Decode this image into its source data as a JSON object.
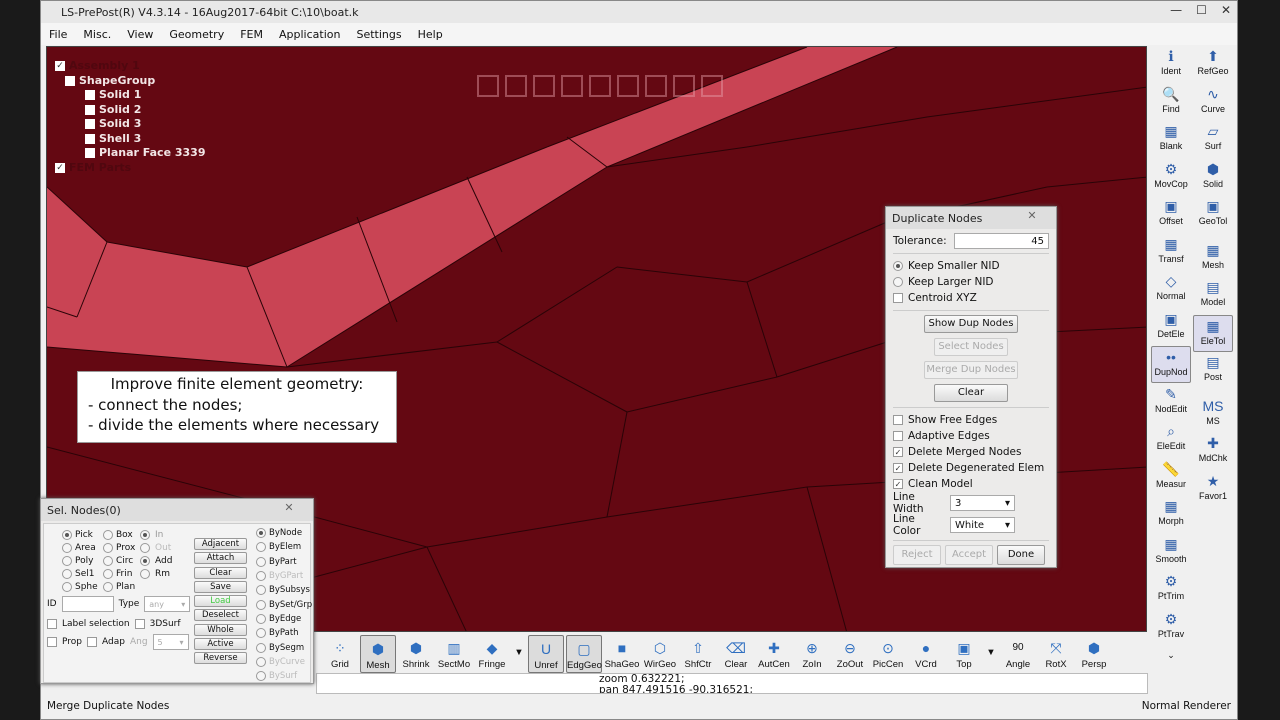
{
  "window": {
    "title": "LS-PrePost(R) V4.3.14 - 16Aug2017-64bit C:\\10\\boat.k",
    "min": "—",
    "max": "☐",
    "close": "✕"
  },
  "menu": [
    "File",
    "Misc.",
    "View",
    "Geometry",
    "FEM",
    "Application",
    "Settings",
    "Help"
  ],
  "tree": {
    "items": [
      {
        "label": "Assembly 1",
        "checked": true,
        "dim": true,
        "indent": 0
      },
      {
        "label": "ShapeGroup",
        "checked": false,
        "indent": 1
      },
      {
        "label": "Solid 1",
        "checked": false,
        "indent": 2
      },
      {
        "label": "Solid 2",
        "checked": false,
        "indent": 2
      },
      {
        "label": "Solid 3",
        "checked": false,
        "indent": 2
      },
      {
        "label": "Shell 3",
        "checked": false,
        "indent": 2
      },
      {
        "label": "Planar Face 3339",
        "checked": false,
        "indent": 2
      },
      {
        "label": "FEM Parts",
        "checked": true,
        "dim": true,
        "indent": 0
      }
    ]
  },
  "note": {
    "line1": "Improve finite element geometry:",
    "line2": "- connect the nodes;",
    "line3": "- divide the elements where necessary"
  },
  "viewport_colors": {
    "background": "#640812",
    "band": "#c94454",
    "lines": "#2a0307"
  },
  "dup": {
    "title": "Duplicate Nodes",
    "close": "✕",
    "tolerance_label": "Tolerance:",
    "tolerance": "45",
    "keep_smaller": "Keep Smaller NID",
    "keep_larger": "Keep Larger NID",
    "centroid": "Centroid XYZ",
    "show": "Show Dup Nodes",
    "select": "Select Nodes",
    "merge": "Merge Dup Nodes",
    "clear": "Clear",
    "free_edges": "Show Free Edges",
    "adaptive": "Adaptive Edges",
    "del_merged": "Delete Merged Nodes",
    "del_degen": "Delete Degenerated Elem",
    "clean": "Clean Model",
    "line_width_label": "Line Width",
    "line_width": "3",
    "line_color_label": "Line Color",
    "line_color": "White",
    "reject": "Reject",
    "accept": "Accept",
    "done": "Done"
  },
  "sel": {
    "title": "Sel. Nodes(0)",
    "close": "✕",
    "modes": [
      [
        "Pick",
        "Box"
      ],
      [
        "Area",
        "Prox"
      ],
      [
        "Poly",
        "Circ"
      ],
      [
        "Sel1",
        "Frin"
      ],
      [
        "Sphe",
        "Plan"
      ]
    ],
    "in": "In",
    "out": "Out",
    "add": "Add",
    "rm": "Rm",
    "buttons": [
      "Adjacent",
      "Attach",
      "Clear",
      "Save",
      "Load",
      "Deselect",
      "Whole",
      "Active",
      "Reverse"
    ],
    "by": [
      "ByNode",
      "ByElem",
      "ByPart",
      "ByGPart",
      "BySubsys",
      "BySet/Grp",
      "ByEdge",
      "ByPath",
      "BySegm",
      "ByCurve",
      "BySurf"
    ],
    "id_label": "ID",
    "type_label": "Type",
    "type_value": "any",
    "label_sel": "Label selection",
    "surf3d": "3DSurf",
    "prop": "Prop",
    "adap": "Adap",
    "ang_label": "Ang",
    "ang_value": "5"
  },
  "right_toolbar": {
    "left": [
      "Ident",
      "Find",
      "Blank",
      "MovCop",
      "Offset",
      "Transf",
      "Normal",
      "DetEle",
      "DupNod",
      "NodEdit",
      "EleEdit",
      "Measur",
      "Morph",
      "Smooth",
      "PtTrim",
      "PtTrav"
    ],
    "right": [
      "RefGeo",
      "Curve",
      "Surf",
      "Solid",
      "GeoTol",
      "Mesh",
      "Model",
      "EleTol",
      "Post",
      "MS",
      "MdChk",
      "Favor1"
    ],
    "more": "⌄"
  },
  "bottom_toolbar": [
    "Grid",
    "Mesh",
    "Shrink",
    "SectMo",
    "Fringe",
    "▼",
    "Unref",
    "EdgGeo",
    "ShaGeo",
    "WirGeo",
    "ShfCtr",
    "Clear",
    "AutCen",
    "ZoIn",
    "ZoOut",
    "PicCen",
    "VCrd",
    "Top",
    "▼",
    "Angle",
    "RotX",
    "Persp"
  ],
  "angle_value": "90",
  "command": {
    "line1": "zoom 0.632221;",
    "line2": "pan 847.491516 -90.316521;"
  },
  "status": {
    "left": "Merge Duplicate Nodes",
    "right": "Normal Renderer"
  }
}
